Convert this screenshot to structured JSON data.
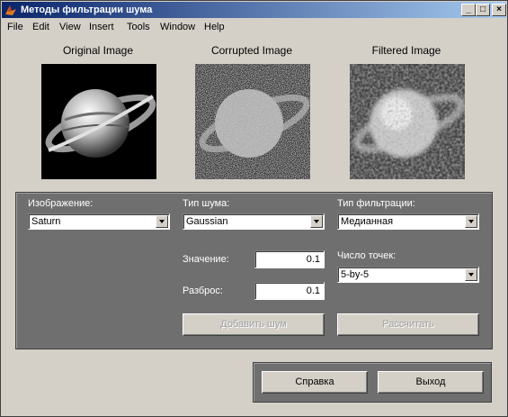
{
  "window": {
    "title": "Методы фильтрации шума"
  },
  "titlebar_buttons": {
    "minimize": "_",
    "maximize": "□",
    "close": "×"
  },
  "menu": [
    "File",
    "Edit",
    "View",
    "Insert",
    "Tools",
    "Window",
    "Help"
  ],
  "images": {
    "original_label": "Original Image",
    "corrupted_label": "Corrupted Image",
    "filtered_label": "Filtered Image"
  },
  "controls": {
    "image_label": "Изображение:",
    "image_value": "Saturn",
    "noise_label": "Тип шума:",
    "noise_value": "Gaussian",
    "filter_label": "Тип фильтрации:",
    "filter_value": "Медианная",
    "value_label": "Значение:",
    "value_value": "0.1",
    "spread_label": "Разброс:",
    "spread_value": "0.1",
    "points_label": "Число точек:",
    "points_value": "5-by-5",
    "add_noise_button": "Добавить шум",
    "compute_button": "Рассчитать"
  },
  "footer": {
    "help_button": "Справка",
    "exit_button": "Выход"
  },
  "colors": {
    "panel": "#6f6f6f",
    "titlebar_start": "#0a246a",
    "titlebar_end": "#a6caf0"
  }
}
